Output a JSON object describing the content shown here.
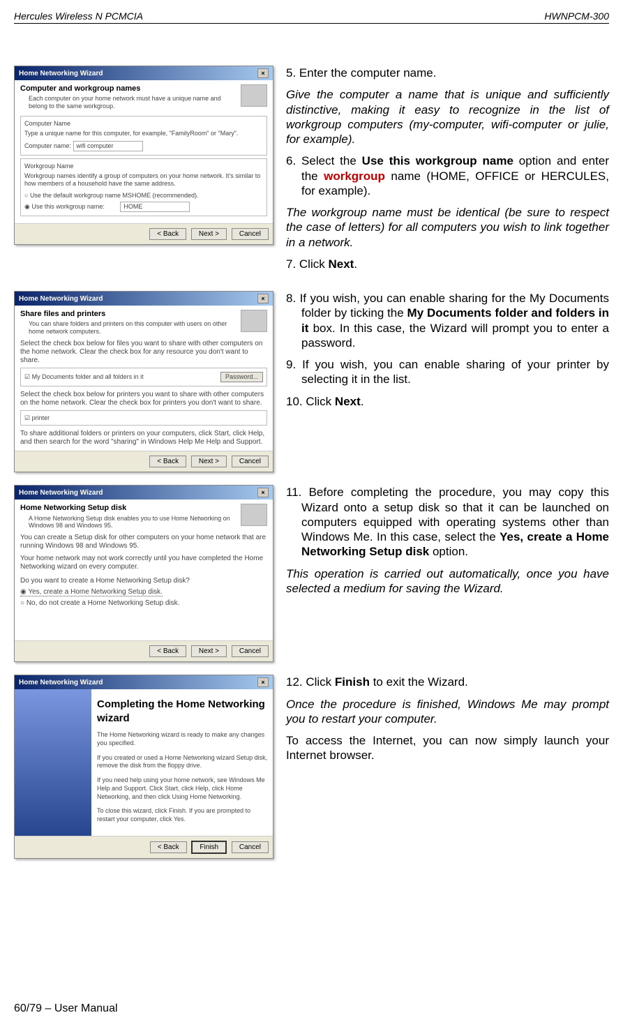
{
  "header": {
    "left": "Hercules Wireless N PCMCIA",
    "right": "HWNPCM-300"
  },
  "dialog1": {
    "title": "Home Networking Wizard",
    "heading": "Computer and workgroup names",
    "sub": "Each computer on your home network must have a unique name and belong to the same workgroup.",
    "group1_label": "Computer Name",
    "group1_text": "Type a unique name for this computer, for example, \"FamilyRoom\" or \"Mary\".",
    "computer_name_label": "Computer name:",
    "computer_name_value": "wifi computer",
    "group2_label": "Workgroup Name",
    "group2_text": "Workgroup names identify a group of computers on your home network. It's similar to how members of a household have the same address.",
    "radio_default": "Use the default workgroup name MSHOME (recommended).",
    "radio_custom": "Use this workgroup name:",
    "workgroup_value": "HOME",
    "back": "< Back",
    "next": "Next >",
    "cancel": "Cancel"
  },
  "dialog2": {
    "title": "Home Networking Wizard",
    "heading": "Share files and printers",
    "sub": "You can share folders and printers on this computer with users on other home network computers.",
    "text1": "Select the check box below for files you want to share with other computers on the home network. Clear the check box for any resource you don't want to share.",
    "check_label": "My Documents folder and all folders in it",
    "password_btn": "Password...",
    "text2": "Select the check box below for printers you want to share with other computers on the home network. Clear the check box for printers you don't want to share.",
    "printer_label": "printer",
    "text3": "To share additional folders or printers on your computers, click Start, click Help, and then search for the word \"sharing\" in Windows Help Me Help and Support.",
    "back": "< Back",
    "next": "Next >",
    "cancel": "Cancel"
  },
  "dialog3": {
    "title": "Home Networking Wizard",
    "heading": "Home Networking Setup disk",
    "sub": "A Home Networking Setup disk enables you to use Home Networking on Windows 98 and Windows 95.",
    "text1": "You can create a Setup disk for other computers on your home network that are running Windows 98 and Windows 95.",
    "text2": "Your home network may not work correctly until you have completed the Home Networking wizard on every computer.",
    "question": "Do you want to create a Home Networking Setup disk?",
    "radio_yes": "Yes, create a Home Networking Setup disk.",
    "radio_no": "No, do not create a Home Networking Setup disk.",
    "back": "< Back",
    "next": "Next >",
    "cancel": "Cancel"
  },
  "dialog4": {
    "title": "Home Networking Wizard",
    "ctitle": "Completing the Home Networking wizard",
    "line1": "The Home Networking wizard is ready to make any changes you specified.",
    "line2": "If you created or used a Home Networking wizard Setup disk, remove the disk from the floppy drive.",
    "line3": "If you need help using your home network, see Windows Me Help and Support. Click Start, click Help, click Home Networking, and then click Using Home Networking.",
    "line4": "To close this wizard, click Finish. If you are prompted to restart your computer, click Yes.",
    "back": "< Back",
    "finish": "Finish",
    "cancel": "Cancel"
  },
  "instructions": {
    "s5": "5.  Enter the computer name.",
    "s5_i": "Give the computer a name that is unique and sufficiently distinctive, making it easy to recognize in the list of workgroup computers (my-computer, wifi-computer or julie, for example).",
    "s6_pre": "6.  Select the ",
    "s6_b": "Use this workgroup name",
    "s6_mid": " option and enter the ",
    "s6_wg": "workgroup",
    "s6_post": " name (HOME, OFFICE or HERCULES, for example).",
    "s6_i": "The workgroup name must be identical (be sure to respect the case of letters) for all computers you wish to link together in a network.",
    "s7_pre": "7.  Click ",
    "s7_b": "Next",
    "s7_post": ".",
    "s8_pre": "8.  If you wish, you can enable sharing for the My Documents folder by ticking the ",
    "s8_b": "My Documents folder and folders in it",
    "s8_post": " box.  In this case, the Wizard will prompt you to enter a password.",
    "s9": "9.  If you wish, you can enable sharing of your printer by selecting it in the list.",
    "s10_pre": "10. Click ",
    "s10_b": "Next",
    "s10_post": ".",
    "s11_pre": "11. Before completing the procedure, you may copy this Wizard onto a setup disk so that it can be launched on computers equipped with operating systems other than Windows Me.  In this case, select the ",
    "s11_b": "Yes, create a Home Networking Setup disk",
    "s11_post": " option.",
    "s11_i": "This operation is carried out automatically, once you have selected a medium for saving the Wizard.",
    "s12_pre": "12. Click ",
    "s12_b": "Finish",
    "s12_post": " to exit the Wizard.",
    "s12_i": "Once the procedure is finished, Windows Me may prompt you to restart your computer.",
    "s12_last": "To access the Internet, you can now simply launch your Internet browser."
  },
  "footer": "60/79 – User Manual"
}
